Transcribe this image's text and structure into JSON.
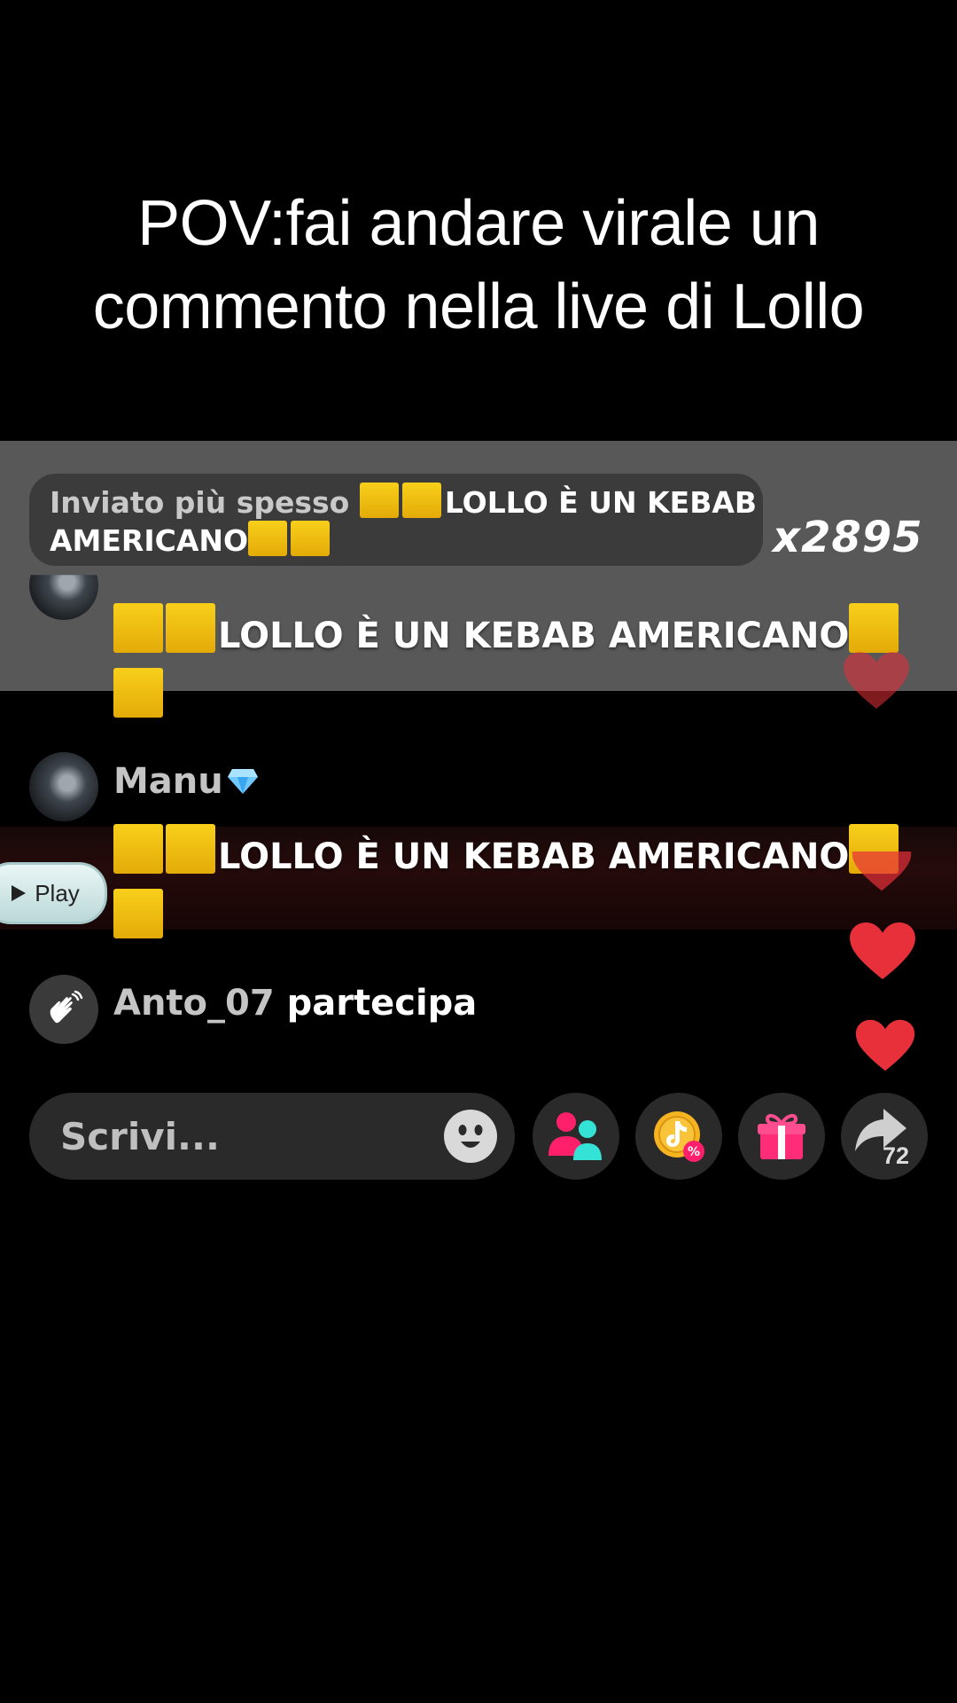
{
  "caption": "POV:fai andare virale un commento nella live di Lollo",
  "pinned": {
    "prefix": "Inviato più spesso ",
    "text_line1": "LOLLO È UN KEBAB",
    "text_line2": "AMERICANO",
    "count": "x2895"
  },
  "comments": [
    {
      "username": "",
      "message": "LOLLO È UN KEBAB AMERICANO"
    },
    {
      "username": "Manu",
      "message": "LOLLO È UN KEBAB AMERICANO"
    }
  ],
  "play_button": "Play",
  "join": {
    "username": "Anto_07",
    "action": "partecipa"
  },
  "input": {
    "placeholder": "Scrivi..."
  },
  "share_count": "72",
  "colors": {
    "background": "#000000",
    "band": "#585858",
    "heart": "#e8303a",
    "square": "#f2c112",
    "accent_pink": "#ff1f6b",
    "accent_cyan": "#35e3d6"
  },
  "icons": [
    "heart-icon",
    "emoji-icon",
    "friends-icon",
    "tiktok-coin-icon",
    "gift-icon",
    "share-icon",
    "wave-hand-icon",
    "diamond-icon",
    "play-icon"
  ]
}
